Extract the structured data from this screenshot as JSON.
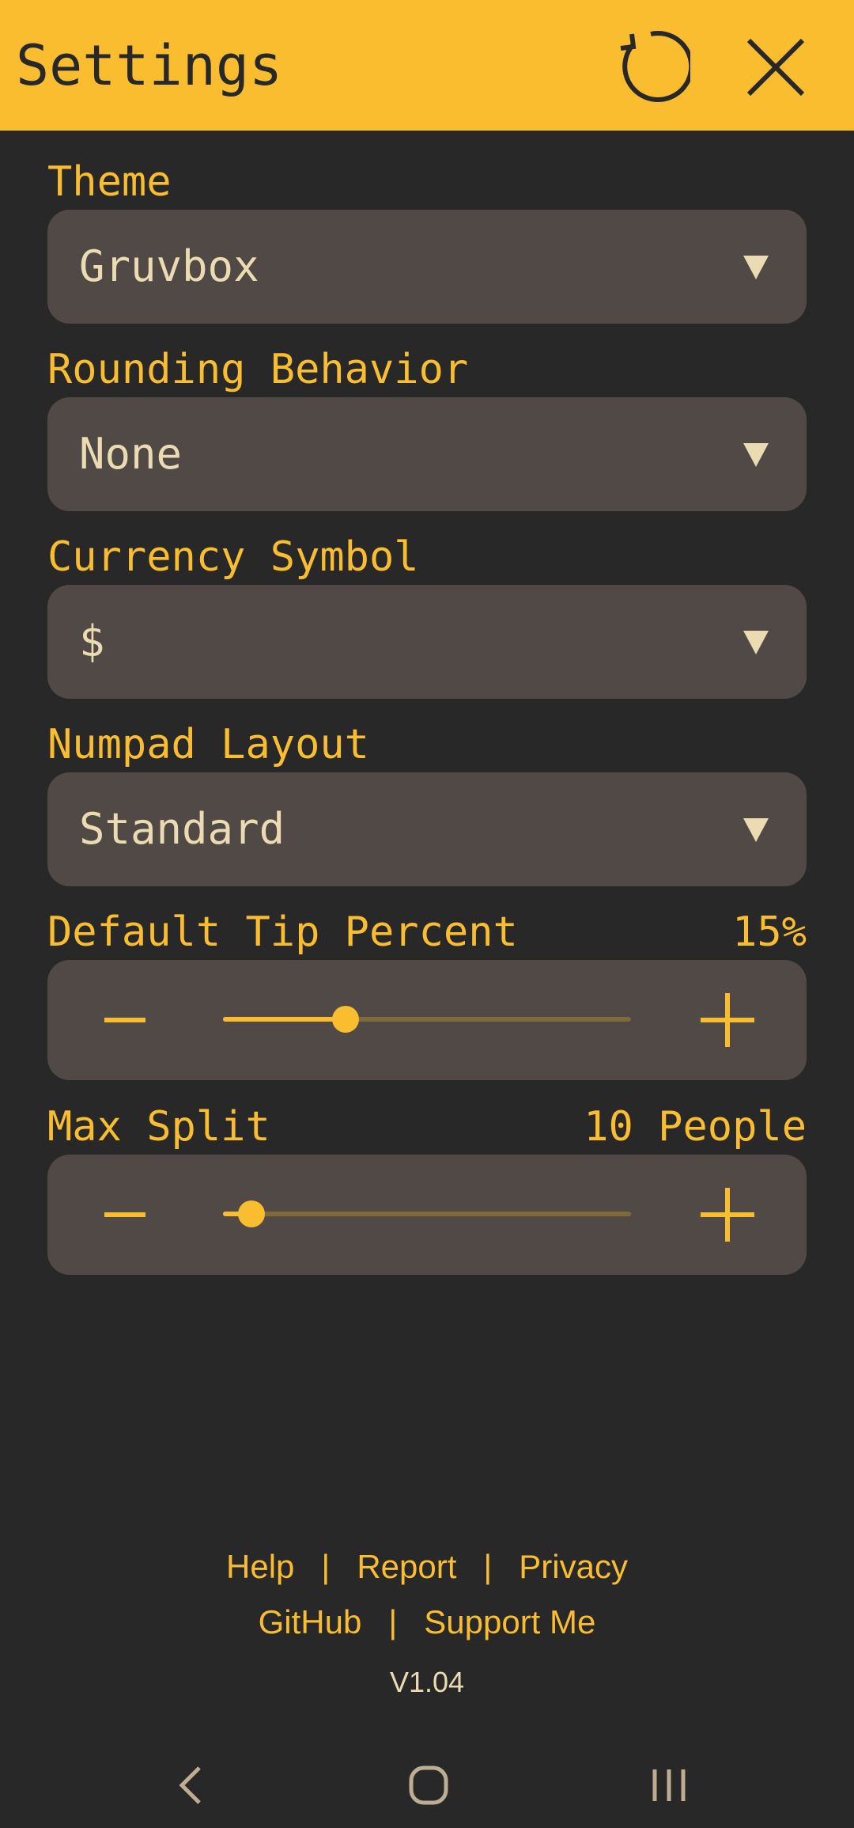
{
  "header": {
    "title": "Settings",
    "reset_icon": "refresh-icon",
    "close_icon": "close-icon",
    "background_color": "#fabd2f"
  },
  "settings": {
    "theme": {
      "label": "Theme",
      "value": "Gruvbox"
    },
    "rounding": {
      "label": "Rounding Behavior",
      "value": "None"
    },
    "currency": {
      "label": "Currency Symbol",
      "value": "$"
    },
    "numpad": {
      "label": "Numpad Layout",
      "value": "Standard"
    },
    "tip": {
      "label": "Default Tip Percent",
      "value": "15%",
      "slider_fraction": 0.3
    },
    "split": {
      "label": "Max Split",
      "value": "10 People",
      "slider_fraction": 0.07
    }
  },
  "footer": {
    "links_row1": [
      "Help",
      "Report",
      "Privacy"
    ],
    "links_row2": [
      "GitHub",
      "Support Me"
    ],
    "separator": "|",
    "version": "V1.04"
  },
  "nav": {
    "back_icon": "back-icon",
    "home_icon": "home-icon",
    "recent_icon": "recent-apps-icon"
  },
  "colors": {
    "accent": "#fabd2f",
    "background": "#282828",
    "panel": "#504945",
    "text_light": "#ebdbb2"
  }
}
